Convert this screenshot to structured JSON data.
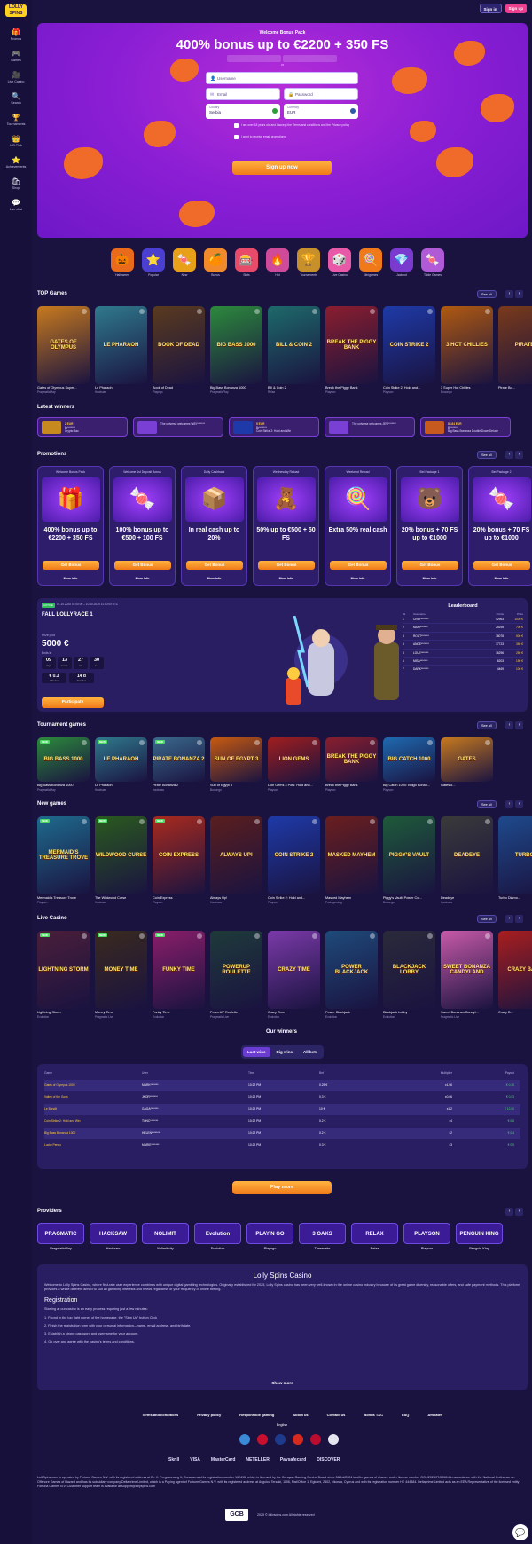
{
  "brand": {
    "logo": "LOLLY SPINS"
  },
  "sidebar": [
    {
      "icon": "🎁",
      "label": "Promos"
    },
    {
      "icon": "🎮",
      "label": "Games"
    },
    {
      "icon": "🎥",
      "label": "Live Casino"
    },
    {
      "icon": "🔍",
      "label": "Search"
    },
    {
      "icon": "🏆",
      "label": "Tournaments"
    },
    {
      "icon": "👑",
      "label": "VIP Club"
    },
    {
      "icon": "⭐",
      "label": "Achievements"
    },
    {
      "icon": "🛍",
      "label": "Shop"
    },
    {
      "icon": "💬",
      "label": "Live chat"
    }
  ],
  "header": {
    "signin": "Sign in",
    "signup": "Sign up"
  },
  "hero": {
    "subtitle": "Welcome Bonus Pack",
    "title": "400% bonus up to €2200 + 350 FS",
    "or": "or",
    "username": "Username",
    "email": "Email",
    "password": "Password",
    "country_label": "Country",
    "country": "Serbia",
    "currency_label": "Currency",
    "currency": "EUR",
    "terms": "I am over 18 years old and I accept the Terms and conditions and the Privacy policy",
    "promo_opt": "I want to receive email promotions",
    "cta": "Sign up now"
  },
  "categories": [
    {
      "icon": "🎃",
      "label": "Halloween"
    },
    {
      "icon": "⭐",
      "label": "Popular"
    },
    {
      "icon": "🍬",
      "label": "New"
    },
    {
      "icon": "🍊",
      "label": "Bonus"
    },
    {
      "icon": "🎰",
      "label": "Slots"
    },
    {
      "icon": "🔥",
      "label": "Hot"
    },
    {
      "icon": "🏆",
      "label": "Tournaments"
    },
    {
      "icon": "🎲",
      "label": "Live Casino"
    },
    {
      "icon": "🍭",
      "label": "Minigames"
    },
    {
      "icon": "💎",
      "label": "Jackpot"
    },
    {
      "icon": "🍬",
      "label": "Table Games"
    }
  ],
  "top_games": {
    "title": "TOP Games",
    "see_all": "See all",
    "items": [
      {
        "art": "GATES OF OLYMPUS",
        "name": "Gates of Olympus Super...",
        "provider": "PragmaticPlay",
        "color": "#c77a1e"
      },
      {
        "art": "LE PHARAOH",
        "name": "Le Pharaoh",
        "provider": "Hacksaw",
        "color": "#2f7a8c"
      },
      {
        "art": "BOOK OF DEAD",
        "name": "Book of Dead",
        "provider": "Playngo",
        "color": "#5a3b1e"
      },
      {
        "art": "BIG BASS 1000",
        "name": "Big Bass Bonanza 1000",
        "provider": "PragmaticPlay",
        "color": "#2c8a3c"
      },
      {
        "art": "BILL & COIN 2",
        "name": "Bill & Coin 2",
        "provider": "Relax",
        "color": "#1d6a6a"
      },
      {
        "art": "BREAK THE PIGGY BANK",
        "name": "Break the Piggy Bank",
        "provider": "Playson",
        "color": "#8a1e2e"
      },
      {
        "art": "COIN STRIKE 2",
        "name": "Coin Strike 2: Hold and...",
        "provider": "Playson",
        "color": "#1e3aa8"
      },
      {
        "art": "3 HOT CHILLIES",
        "name": "3 Super Hot Chillies",
        "provider": "Booongo",
        "color": "#b05a10"
      },
      {
        "art": "PIRATE",
        "name": "Pirate Bo...",
        "provider": "",
        "color": "#7a3a1a"
      }
    ]
  },
  "latest_winners": {
    "title": "Latest winners",
    "items": [
      {
        "amount": "2 EUR",
        "text": "Br*******",
        "extra": "Crypto Bac",
        "color": "#c78a1e"
      },
      {
        "amount": "",
        "text": "The universe welcomes WAY*******",
        "extra": "",
        "color": "#7a3fd4"
      },
      {
        "amount": "5 EUR",
        "text": "Br*******",
        "extra": "Coin Strike 2: Hold and Win",
        "color": "#1e3aa8"
      },
      {
        "amount": "",
        "text": "The universe welcomes JEVI*******",
        "extra": "",
        "color": "#7a3fd4"
      },
      {
        "amount": "86.84 EUR",
        "text": "Br*******",
        "extra": "Big Bass Bonanza Double Down Deluxe",
        "color": "#c75a1e"
      }
    ]
  },
  "promotions": {
    "title": "Promotions",
    "see_all": "See all",
    "items": [
      {
        "tag": "Welcome Bonus Pack",
        "icon": "🎁",
        "headline": "400% bonus up to €2200 + 350 FS",
        "btn": "Get Bonus",
        "more": "More info"
      },
      {
        "tag": "Welcome 1st Deposit Bonus",
        "icon": "🍬",
        "headline": "100% bonus up to €500 + 100 FS",
        "btn": "Get Bonus",
        "more": "More info"
      },
      {
        "tag": "Daily Cashback",
        "icon": "📦",
        "headline": "In real cash up to 20%",
        "btn": "Get Bonus",
        "more": "More info"
      },
      {
        "tag": "Wednesday Reload",
        "icon": "🧸",
        "headline": "50% up to €500 + 50 FS",
        "btn": "Get Bonus",
        "more": "More info"
      },
      {
        "tag": "Weekend Reload",
        "icon": "🍭",
        "headline": "Extra 50% real cash",
        "btn": "Get Bonus",
        "more": "More info"
      },
      {
        "tag": "Bet Package 1",
        "icon": "🐻",
        "headline": "20% bonus + 70 FS up to €1000",
        "btn": "Get Bonus",
        "more": "More info"
      },
      {
        "tag": "Bet Package 2",
        "icon": "🍬",
        "headline": "20% bonus + 70 FS up to €1000",
        "btn": "Get Bonus",
        "more": "More info"
      }
    ]
  },
  "tournament": {
    "status": "ACTIVE",
    "dates": "01.10.2025 01:00:00 – 10.10.2025 11:00:00 UTC",
    "name": "FALL LOLLYRACE 1",
    "prize_label": "Prize pool",
    "prize": "5000 €",
    "ends_label": "Ends in",
    "timer": [
      {
        "v": "09",
        "u": "days"
      },
      {
        "v": "13",
        "u": "hours"
      },
      {
        "v": "27",
        "u": "min"
      },
      {
        "v": "30",
        "u": "sec"
      }
    ],
    "stats": [
      {
        "v": "€ 0.3",
        "u": "Min bet"
      },
      {
        "v": "14 d",
        "u": "Duration"
      }
    ],
    "btn": "Participate",
    "leaderboard": {
      "title": "Leaderboard",
      "cols": [
        "№",
        "Username",
        "Points",
        "Prize"
      ],
      "rows": [
        [
          "1",
          "CREY*******",
          "42963",
          "1000 €"
        ],
        [
          "2",
          "MARI*******",
          "29295",
          "700 €"
        ],
        [
          "3",
          "ROUT*******",
          "18078",
          "500 €"
        ],
        [
          "4",
          "ANGE*******",
          "17723",
          "350 €"
        ],
        [
          "5",
          "LOUE*******",
          "16296",
          "250 €"
        ],
        [
          "6",
          "MISA*******",
          "6203",
          "150 €"
        ],
        [
          "7",
          "DARK*******",
          "4469",
          "100 €"
        ]
      ]
    }
  },
  "tournament_games": {
    "title": "Tournament games",
    "see_all": "See all",
    "items": [
      {
        "art": "BIG BASS 1000",
        "name": "Big Bass Bonanza 1000",
        "provider": "PragmaticPlay",
        "color": "#2c8a3c"
      },
      {
        "art": "LE PHARAOH",
        "name": "Le Pharaoh",
        "provider": "Hacksaw",
        "color": "#2f7a8c"
      },
      {
        "art": "PIRATE BONANZA 2",
        "name": "Pirate Bonanza 2",
        "provider": "Hacksaw",
        "color": "#3a6a8c"
      },
      {
        "art": "SUN OF EGYPT 3",
        "name": "Sun of Egypt 3",
        "provider": "Booongo",
        "color": "#c75a10"
      },
      {
        "art": "LION GEMS",
        "name": "Lion Gems 3 Pots: Hold and...",
        "provider": "Playson",
        "color": "#a01e1e"
      },
      {
        "art": "BREAK THE PIGGY BANK",
        "name": "Break the Piggy Bank",
        "provider": "Playson",
        "color": "#8a1e2e"
      },
      {
        "art": "BIG CATCH 1000",
        "name": "Big Catch 1000: Bulgo Bonan...",
        "provider": "Playson",
        "color": "#1e6ab0"
      },
      {
        "art": "GATES",
        "name": "Gates o...",
        "provider": "",
        "color": "#c77a1e"
      }
    ]
  },
  "new_games": {
    "title": "New games",
    "see_all": "See all",
    "items": [
      {
        "art": "MERMAID'S TREASURE TROVE",
        "name": "Mermaid's Treasure Trove",
        "provider": "Playson",
        "color": "#1e6a8c"
      },
      {
        "art": "WILDWOOD CURSE",
        "name": "The Wildwood Curse",
        "provider": "Hacksaw",
        "color": "#2a5a1e"
      },
      {
        "art": "COIN EXPRESS",
        "name": "Coin Express",
        "provider": "Playson",
        "color": "#a82a1e"
      },
      {
        "art": "ALWAYS UP!",
        "name": "Always Up!",
        "provider": "Hacksaw",
        "color": "#5a1e1e"
      },
      {
        "art": "COIN STRIKE 2",
        "name": "Coin Strike 2: Hold and...",
        "provider": "Playson",
        "color": "#1e3aa8"
      },
      {
        "art": "MASKED MAYHEM",
        "name": "Masked Mayhem",
        "provider": "Push gaming",
        "color": "#6a1e1e"
      },
      {
        "art": "PIGGY'S VAULT",
        "name": "Piggy's Vault: Power Coi...",
        "provider": "Booongo",
        "color": "#1e5a3a"
      },
      {
        "art": "DEADEYE",
        "name": "Deadeye",
        "provider": "Hacksaw",
        "color": "#3a3a3a"
      },
      {
        "art": "TURBO",
        "name": "Turbo Diamo...",
        "provider": "",
        "color": "#1e4a8c"
      }
    ]
  },
  "live_casino": {
    "title": "Live Casino",
    "see_all": "See all",
    "items": [
      {
        "art": "LIGHTNING STORM",
        "name": "Lightning Storm",
        "provider": "Evolution",
        "color": "#4a1e3a"
      },
      {
        "art": "MONEY TIME",
        "name": "Money Time",
        "provider": "Pragmatic Live",
        "color": "#3a2a1e"
      },
      {
        "art": "FUNKY TIME",
        "name": "Funky Time",
        "provider": "Evolution",
        "color": "#8a1e6a"
      },
      {
        "art": "POWERUP ROULETTE",
        "name": "PowerUP Roulette",
        "provider": "Pragmatic Live",
        "color": "#1e3a3a"
      },
      {
        "art": "CRAZY TIME",
        "name": "Crazy Time",
        "provider": "Evolution",
        "color": "#7a3aa8"
      },
      {
        "art": "POWER BLACKJACK",
        "name": "Power Blackjack",
        "provider": "Evolution",
        "color": "#1e4a7a"
      },
      {
        "art": "BLACKJACK LOBBY",
        "name": "Blackjack Lobby",
        "provider": "Evolution",
        "color": "#2a2a3a"
      },
      {
        "art": "SWEET BONANZA CANDYLAND",
        "name": "Sweet Bonanza Candyl...",
        "provider": "Pragmatic Live",
        "color": "#c75aa8"
      },
      {
        "art": "CRAZY BALL",
        "name": "Crazy B...",
        "provider": "",
        "color": "#a81e1e"
      }
    ]
  },
  "our_winners": {
    "title": "Our winners",
    "tabs": [
      "Last wins",
      "Big wins",
      "All bets"
    ],
    "cols": [
      "Game",
      "User",
      "Time",
      "Bet",
      "Multiplier",
      "Payout"
    ],
    "rows": [
      [
        "Gates of Olympus 1000",
        "MARK*******",
        "10:22 PM",
        "0.25 €",
        "x1.06",
        "€ 0.26"
      ],
      [
        "Valley of the Gods",
        "JKOR*******",
        "10:22 PM",
        "0.3 €",
        "x0.06",
        "€ 0.03"
      ],
      [
        "Le Bandit",
        "GAGA*******",
        "10:22 PM",
        "10 €",
        "x1.2",
        "€ 12.00"
      ],
      [
        "Coin Strike 2: Hold and Win",
        "TONC*******",
        "10:22 PM",
        "0.2 €",
        "x4",
        "€ 0.8"
      ],
      [
        "Big Bass Bonanza 1000",
        "HELEN*******",
        "10:22 PM",
        "0.2 €",
        "x2",
        "€ 0.4"
      ],
      [
        "Lucky Penny",
        "MARIE*******",
        "10:22 PM",
        "0.3 €",
        "x3",
        "€ 0.9"
      ]
    ],
    "btn": "Play more"
  },
  "providers": {
    "title": "Providers",
    "items": [
      {
        "logo": "PRAGMATIC",
        "name": "PragmaticPlay"
      },
      {
        "logo": "HACKSAW",
        "name": "Hacksaw"
      },
      {
        "logo": "NOLIMIT",
        "name": "Nolimit city"
      },
      {
        "logo": "Evolution",
        "name": "Evolution"
      },
      {
        "logo": "PLAY'N GO",
        "name": "Playngo"
      },
      {
        "logo": "3 OAKS",
        "name": "Threeoaks"
      },
      {
        "logo": "RELAX",
        "name": "Relax"
      },
      {
        "logo": "PLAYSON",
        "name": "Playson"
      },
      {
        "logo": "PENGUIN KING",
        "name": "Penguin King"
      }
    ]
  },
  "about": {
    "title": "Lolly Spins Casino",
    "intro": "Welcome to Lolly Spins Casino, where first-rate user experience combines with unique digital gambling technologies. Originally established for 2025, Lolly Spins casino has been very well-known in the online casino industry because of its great game diversity, reasonable offers, and safe payment methods. This platform provides a whole different aimed to suit all gambling interests and needs regardless of your frequency of online betting.",
    "reg_title": "Registration",
    "steps": [
      "Starting at our casino is an easy process requiring just a few minutes:",
      "1. Found in the top right corner of the homepage, the \"Sign Up\" button Click",
      "2. Finish the registration form with your personal information—name, email address, and birthdate.",
      "3. Establish a strong password and username for your account.",
      "4. Go over and agree with the casino's terms and conditions."
    ],
    "show_more": "Show more"
  },
  "footer": {
    "links": [
      "Terms and conditions",
      "Privacy policy",
      "Responsible gaming",
      "About us",
      "Contact us",
      "Bonus T&C",
      "FAQ",
      "Affiliates"
    ],
    "language": "English",
    "payments": [
      "Skrill",
      "VISA",
      "MasterCard",
      "NETELLER",
      "Paysafecard",
      "DISCOVER"
    ],
    "legal": "LolliSpins.com is operated by Fortune Games N.V. with its registered address at Dr. H. Fergusonweg 1, Curacao and its registration number 162415, which is licensed by the Curaçao Gaming Control Board since 08/Jul/2024 to offer games of chance under license number OGL/2024/713/0614 in accordance with the National Ordinance on Offshore Games of Hazard and has its subsidiary company Deltaprime Limited, which is a Paying agent of Fortune Games N.V. with its registered address at Avgolou Terzaki, 1106, Flat/Office 1, Egkomi, 2402, Nicosia, Cyprus and with its registration number HE 444484. Deltaprime Limited acts as an EEA Representative of the licensed entity Fortuna Games N.V. Customer support team is available at support@lollyspins.com",
    "gcb": "GCB",
    "copyright": "2025 © lollyspins.com All rights reserved"
  }
}
